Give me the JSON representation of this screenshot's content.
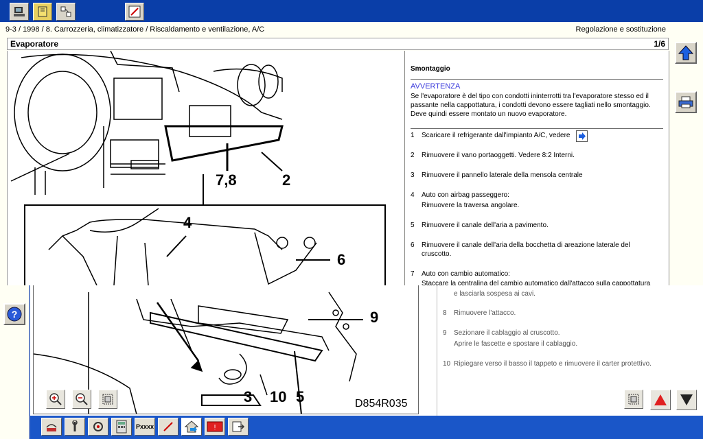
{
  "breadcrumb": {
    "path": "9-3 / 1998 / 8. Carrozzeria, climatizzatore / Riscaldamento e ventilazione, A/C",
    "right": "Regolazione e sostituzione"
  },
  "header": {
    "title": "Evaporatore",
    "page": "1/6"
  },
  "figure": {
    "labels": [
      "7,8",
      "2",
      "4",
      "6",
      "9",
      "3",
      "10",
      "5"
    ],
    "code": "D854R035"
  },
  "content": {
    "section_title": "Smontaggio",
    "warning_title": "AVVERTENZA",
    "warning_lines": [
      "Se l'evaporatore è del tipo con condotti ininterrotti tra l'evaporatore stesso ed il",
      "passante nella cappottatura, i condotti devono essere tagliati nello smontaggio.",
      "Deve quindi essere montato un nuovo evaporatore."
    ],
    "steps": [
      {
        "num": "1",
        "lines": [
          "Scaricare il refrigerante dall'impianto A/C, vedere"
        ]
      },
      {
        "num": "2",
        "lines": [
          "Rimuovere il vano portaoggetti. Vedere 8:2 Interni."
        ]
      },
      {
        "num": "3",
        "lines": [
          "Rimuovere il pannello laterale della mensola centrale"
        ]
      },
      {
        "num": "4",
        "lines": [
          "Auto con airbag passeggero:",
          "Rimuovere la traversa angolare."
        ]
      },
      {
        "num": "5",
        "lines": [
          "Rimuovere il canale dell'aria a pavimento."
        ]
      },
      {
        "num": "6",
        "lines": [
          "Rimuovere il canale dell'aria della bocchetta di areazione laterale del",
          "cruscotto."
        ]
      },
      {
        "num": "7",
        "lines": [
          "Auto con cambio automatico:",
          "Staccare la centralina del cambio automatico dall'attacco sulla cappottatura"
        ]
      }
    ],
    "lower_steps": [
      {
        "num": "",
        "lines": [
          "e lasciarla sospesa ai cavi."
        ]
      },
      {
        "num": "8",
        "lines": [
          "Rimuovere l'attacco."
        ]
      },
      {
        "num": "9",
        "lines": [
          "Sezionare il cablaggio al cruscotto.",
          "Aprire le fascette e spostare il cablaggio."
        ]
      },
      {
        "num": "10",
        "lines": [
          "Ripiegare verso il basso il tappeto e rimuovere il carter protettivo."
        ]
      }
    ]
  },
  "bottom_toolbar": {
    "p_label": "Pxxxx"
  },
  "colors": {
    "titlebar": "#0a3ea8",
    "bottombar": "#1a56c8",
    "warning": "#3a3adc",
    "nav_arrow": "#1c5fe0",
    "up_red": "#e02020"
  }
}
